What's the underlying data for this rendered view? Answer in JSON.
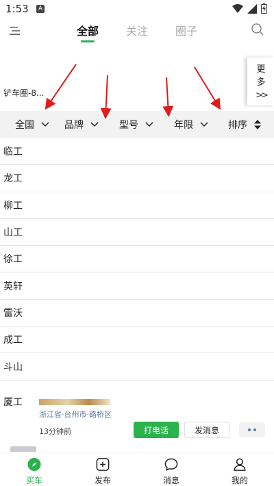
{
  "status_bar": {
    "time": "1:53",
    "badge": "A"
  },
  "header": {
    "tabs": [
      {
        "label": "全部",
        "active": true
      },
      {
        "label": "关注",
        "active": false
      },
      {
        "label": "圈子",
        "active": false
      }
    ]
  },
  "circles": {
    "first_item": "铲车圈-8...",
    "more_label_1": "更",
    "more_label_2": "多",
    "more_chevron": ">>"
  },
  "filters": [
    {
      "label": "全国",
      "icon": "chevron-down-icon"
    },
    {
      "label": "品牌",
      "icon": "chevron-down-icon"
    },
    {
      "label": "型号",
      "icon": "chevron-down-icon"
    },
    {
      "label": "年限",
      "icon": "chevron-down-icon"
    },
    {
      "label": "排序",
      "icon": "sort-icon"
    }
  ],
  "brands": [
    "临工",
    "龙工",
    "柳工",
    "山工",
    "徐工",
    "英轩",
    "雷沃",
    "成工",
    "斗山",
    "厦工"
  ],
  "listing": {
    "location": "浙江省·台州市·路桥区",
    "posted": "13分钟前",
    "call_label": "打电话",
    "message_label": "发消息"
  },
  "bottom_nav": [
    {
      "label": "买车",
      "icon": "compass-icon",
      "active": true
    },
    {
      "label": "发布",
      "icon": "plus-square-icon",
      "active": false
    },
    {
      "label": "消息",
      "icon": "chat-bubble-icon",
      "active": false
    },
    {
      "label": "我的",
      "icon": "person-icon",
      "active": false
    }
  ],
  "colors": {
    "accent": "#2bb24c",
    "annotation": "#e01b1b",
    "filter_bg": "#f2f2f2"
  }
}
